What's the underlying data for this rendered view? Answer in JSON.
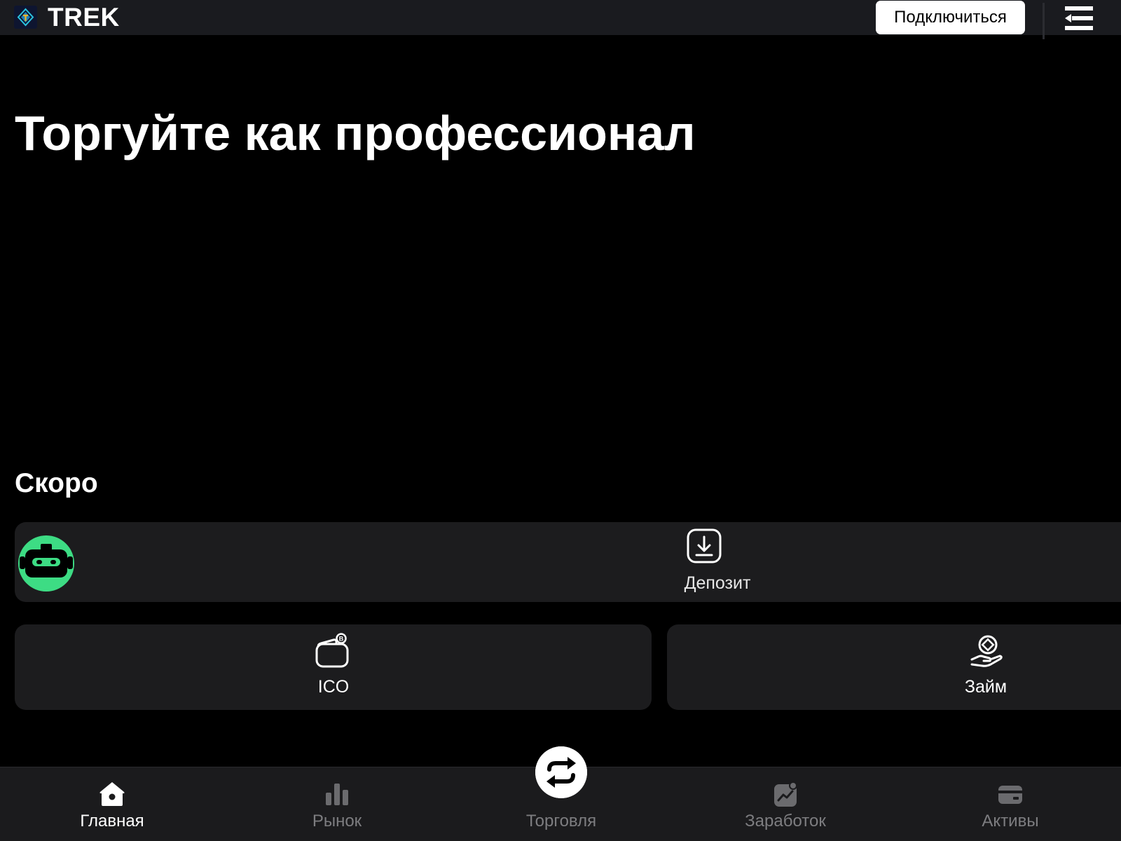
{
  "header": {
    "brand": "TREK",
    "connect_label": "Подключиться",
    "logo_icon": "trek-logo",
    "menu_icon": "menu-collapse-icon"
  },
  "hero": {
    "title": "Торгуйте как профессионал"
  },
  "soon": {
    "title": "Скоро",
    "bot_icon": "robot-icon",
    "cards": [
      {
        "label": "Депозит",
        "icon": "deposit-download-icon"
      },
      {
        "label": "ICO",
        "icon": "wallet-coin-icon"
      },
      {
        "label": "Займ",
        "icon": "hand-coin-icon"
      }
    ]
  },
  "bottom_nav": {
    "items": [
      {
        "label": "Главная",
        "icon": "home-icon",
        "active": true
      },
      {
        "label": "Рынок",
        "icon": "bar-chart-icon",
        "active": false
      },
      {
        "label": "Торговля",
        "icon": "swap-icon",
        "active": false
      },
      {
        "label": "Заработок",
        "icon": "earn-chart-icon",
        "active": false
      },
      {
        "label": "Активы",
        "icon": "wallet-card-icon",
        "active": false
      }
    ]
  },
  "colors": {
    "background": "#000000",
    "header_bg": "#1a1b1f",
    "card_bg": "#1c1c1e",
    "bot_accent": "#3ddc84",
    "nav_inactive": "#7d7d80",
    "nav_active": "#ffffff"
  }
}
